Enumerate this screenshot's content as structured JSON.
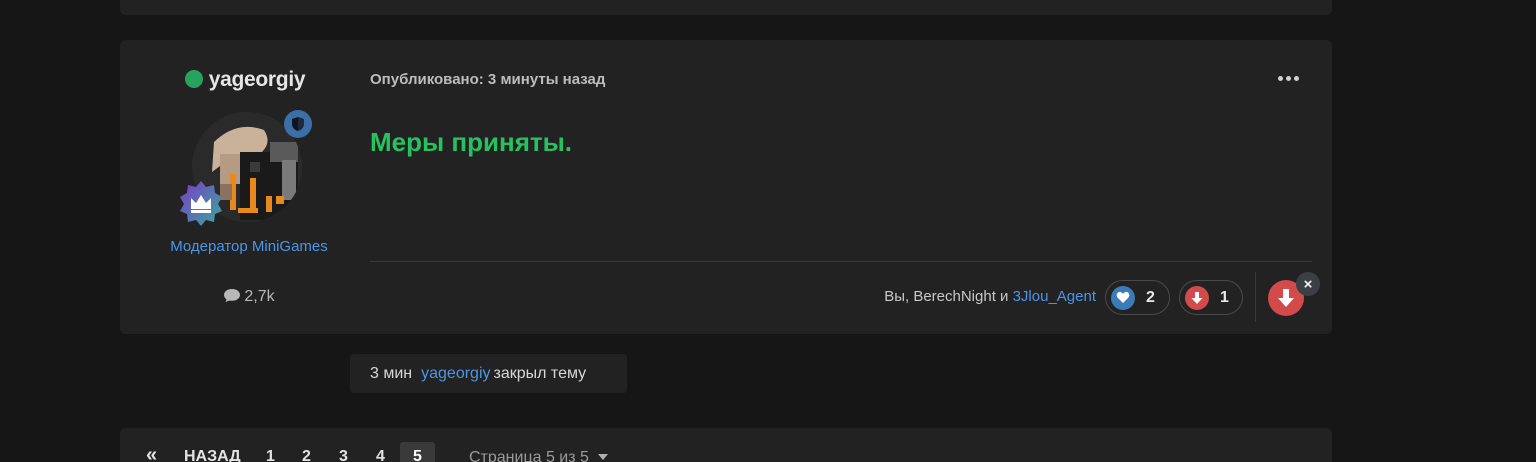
{
  "post": {
    "author": "yageorgiy",
    "role": "Модератор MiniGames",
    "posts_count": "2,7k",
    "published": "Опубликовано: 3 минуты назад",
    "content": "Меры приняты.",
    "likes_prefix": "Вы, BerechNight и ",
    "likes_link": "3Jlou_Agent",
    "reactions": [
      {
        "icon": "heart-icon",
        "count": "2",
        "color": "#3c7ab8"
      },
      {
        "icon": "down-arrow-icon",
        "count": "1",
        "color": "#d24a4a"
      }
    ],
    "remove_label": "×"
  },
  "event": {
    "time": "3 мин",
    "user": "yageorgiy",
    "action": "закрыл тему"
  },
  "pagination": {
    "first": "«",
    "prev": "НАЗАД",
    "pages": [
      "1",
      "2",
      "3",
      "4"
    ],
    "current": "5",
    "page_jump": "Страница 5 из 5"
  },
  "colors": {
    "online": "#27a35f",
    "accent_link": "#4a96e8",
    "content_text": "#27c15f",
    "card_bg": "#222222",
    "page_bg": "#161616"
  }
}
